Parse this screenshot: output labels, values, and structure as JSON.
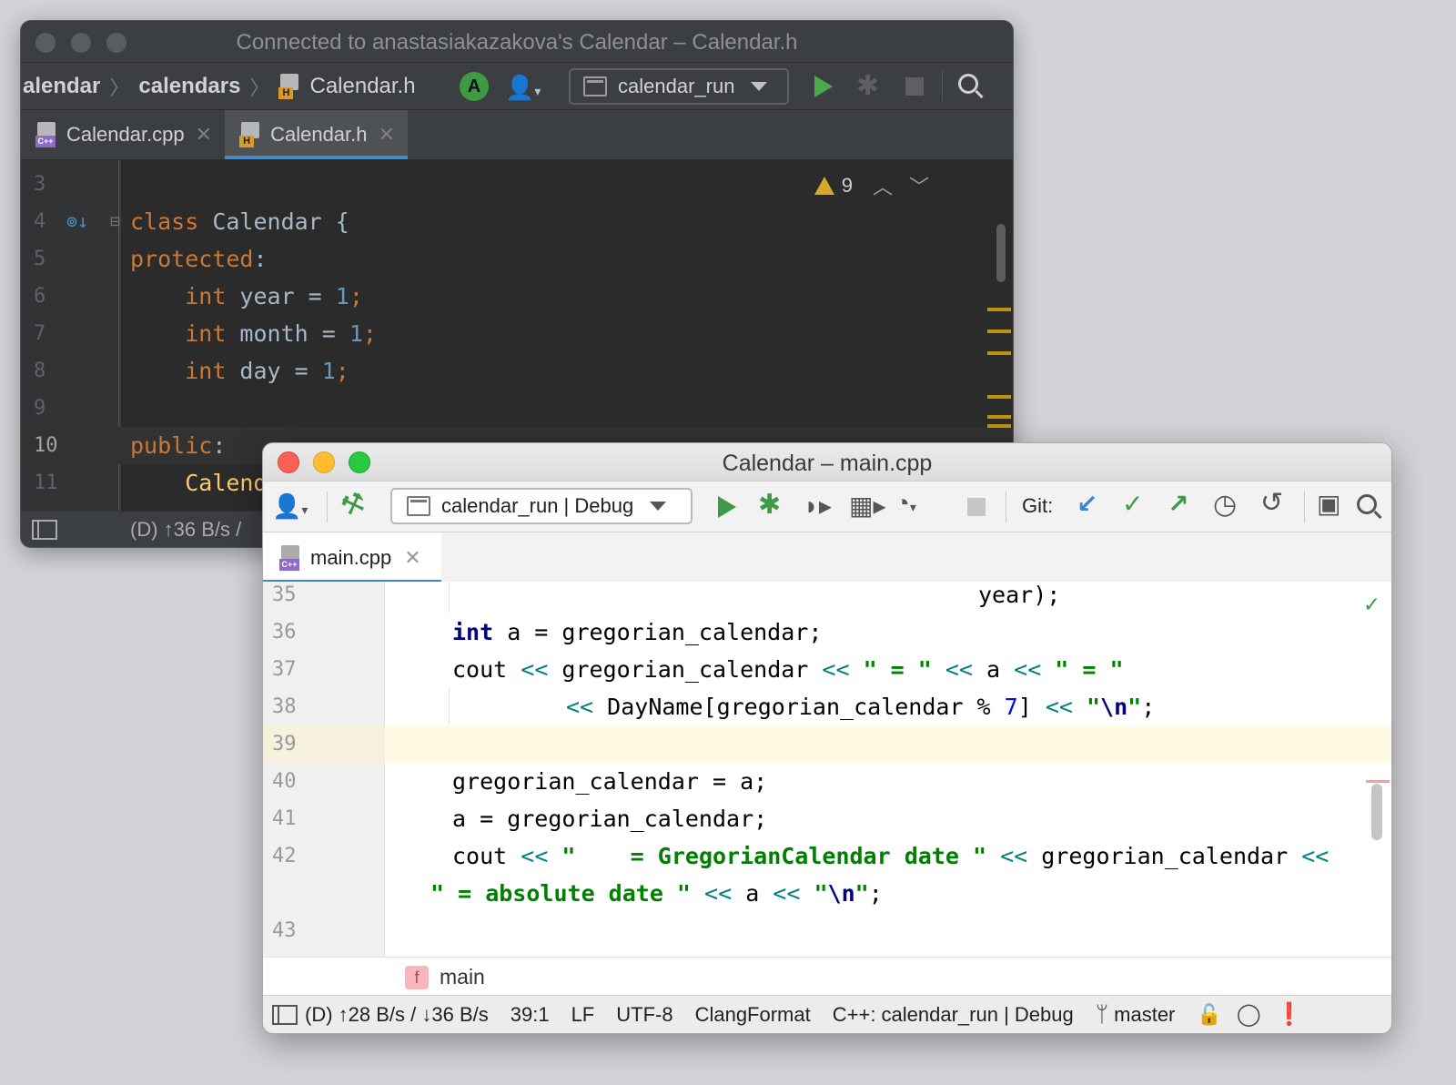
{
  "dark_window": {
    "title": "Connected to anastasiakazakova's Calendar – Calendar.h",
    "breadcrumbs": [
      "alendar",
      "calendars",
      "Calendar.h"
    ],
    "avatar_letter": "A",
    "run_config": "calendar_run",
    "tabs": [
      {
        "label": "Calendar.cpp",
        "active": false
      },
      {
        "label": "Calendar.h",
        "active": true
      }
    ],
    "warnings_count": "9",
    "line_numbers": [
      "3",
      "4",
      "5",
      "6",
      "7",
      "8",
      "9",
      "10",
      "11"
    ],
    "code": {
      "l4_kw": "class",
      "l4_rest": " Calendar {",
      "l5_kw": "protected",
      "l5_rest": ":",
      "l6_kw": "int",
      "l6_mid": " year = ",
      "l6_num": "1",
      "l6_end": ";",
      "l7_kw": "int",
      "l7_mid": " month = ",
      "l7_num": "1",
      "l7_end": ";",
      "l8_kw": "int",
      "l8_mid": " day = ",
      "l8_num": "1",
      "l8_end": ";",
      "l10_kw": "public",
      "l10_rest": ":",
      "l11_cls": "Calend"
    },
    "status_text": "(D) ↑36 B/s / "
  },
  "light_window": {
    "title": "Calendar – main.cpp",
    "run_config": "calendar_run | Debug",
    "git_label": "Git:",
    "tab_label": "main.cpp",
    "line_numbers": [
      "35",
      "36",
      "37",
      "38",
      "39",
      "40",
      "41",
      "42",
      "43"
    ],
    "code": {
      "l35": "year);",
      "l36_kw": "int",
      "l36_rest": " a = gregorian_calendar;",
      "l37_a": "cout ",
      "l37_op1": "<<",
      "l37_b": " gregorian_calendar ",
      "l37_op2": "<<",
      "l37_s1": " \" = \" ",
      "l37_op3": "<<",
      "l37_c": " a ",
      "l37_op4": "<<",
      "l37_s2": " \" = \"",
      "l38_op1": "<<",
      "l38_a": " DayName[gregorian_calendar % ",
      "l38_num": "7",
      "l38_b": "] ",
      "l38_op2": "<<",
      "l38_q1": " \"",
      "l38_esc": "\\n",
      "l38_q2": "\"",
      "l38_end": ";",
      "l40": "gregorian_calendar = a;",
      "l41": "a = gregorian_calendar;",
      "l42_a": "cout ",
      "l42_op1": "<<",
      "l42_str": " \"    = GregorianCalendar date \" ",
      "l42_op2": "<<",
      "l42_b": " gregorian_calendar ",
      "l42_op3": "<<",
      "l42w_str": "\" = absolute date \" ",
      "l42w_op1": "<<",
      "l42w_a": " a ",
      "l42w_op2": "<<",
      "l42w_q1": " \"",
      "l42w_esc": "\\n",
      "l42w_q2": "\"",
      "l42w_end": ";"
    },
    "breadcrumb_function": "main",
    "status": {
      "traffic": "(D) ↑28 B/s / ↓36 B/s",
      "position": "39:1",
      "line_sep": "LF",
      "encoding": "UTF-8",
      "formatter": "ClangFormat",
      "context": "C++: calendar_run | Debug",
      "branch": "master"
    }
  }
}
